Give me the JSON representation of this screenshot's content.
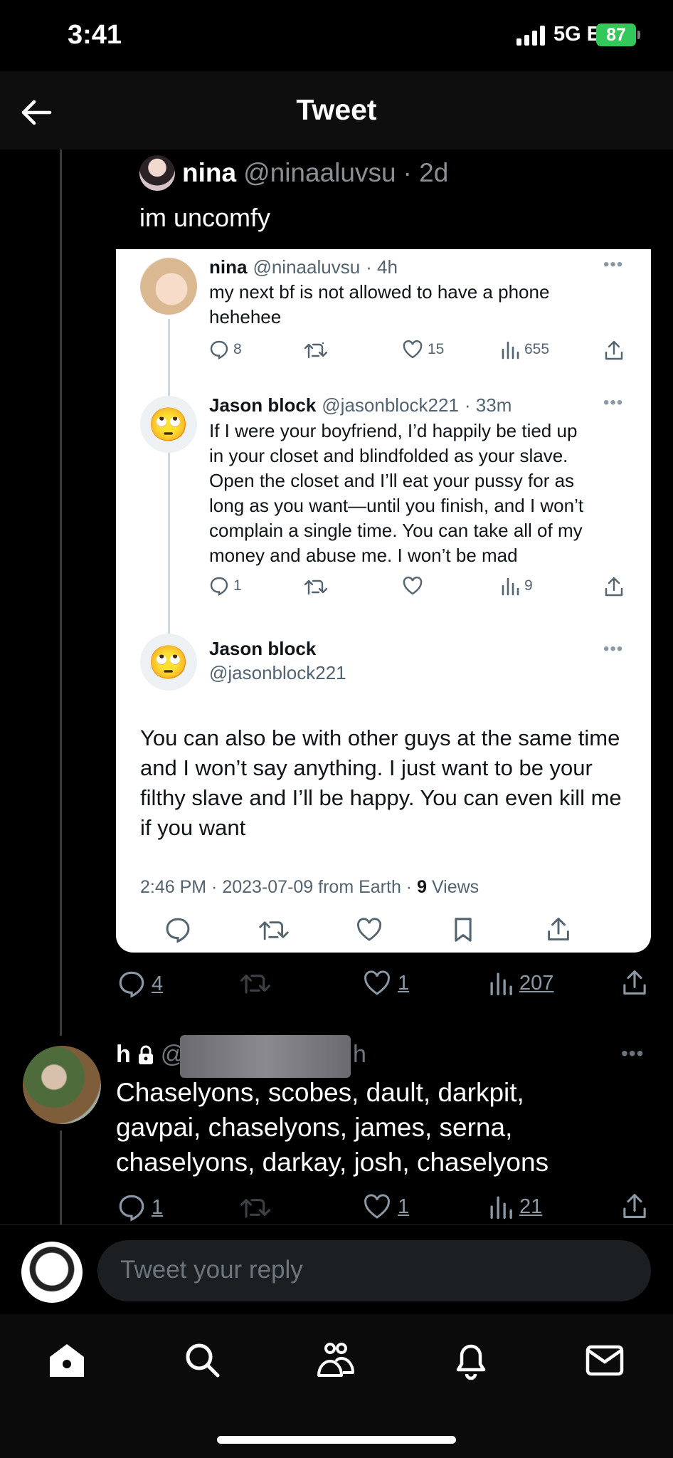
{
  "status": {
    "time": "3:41",
    "network": "5G E",
    "battery": "87"
  },
  "header": {
    "title": "Tweet"
  },
  "quoted": {
    "name": "nina",
    "handle": "@ninaaluvsu",
    "age": "· 2d",
    "text": "im uncomfy"
  },
  "card": {
    "t1": {
      "name": "nina",
      "handle": "@ninaaluvsu",
      "age": "· 4h",
      "lines": [
        "my next bf is not allowed to have a phone",
        "hehehee"
      ],
      "replies": "8",
      "likes": "15",
      "views": "655"
    },
    "t2": {
      "name": "Jason block",
      "handle": "@jasonblock221",
      "age": "· 33m",
      "lines": [
        "If I were your boyfriend, I’d happily be tied up",
        "in your closet and blindfolded as your slave.",
        "Open the closet and I’ll eat your pussy for as",
        "long as you want—until you finish, and I won’t",
        "complain a single time. You can take all of my",
        "money and abuse me. I won’t be mad"
      ],
      "replies": "1",
      "views": "9"
    },
    "t3": {
      "name": "Jason block",
      "handle": "@jasonblock221",
      "lines": [
        "You can also be with other guys at the same time",
        "and I won’t say anything. I just want to be your",
        "filthy slave and I’ll be happy. You can even kill me",
        "if you want"
      ],
      "meta": "2:46 PM · 2023-07-09 from Earth ·",
      "views_count": "9",
      "views_label": "Views"
    },
    "emoji": "🙄"
  },
  "main_actions": {
    "replies": "4",
    "likes": "1",
    "views": "207"
  },
  "reply_tweet": {
    "name": "h",
    "handle_start": "@",
    "handle_end": "h",
    "lines": [
      "Chaselyons, scobes, dault, darkpit,",
      "gavpai, chaselyons, james, serna,",
      "chaselyons, darkay, josh, chaselyons"
    ],
    "replies": "1",
    "likes": "1",
    "views": "21"
  },
  "composer": {
    "placeholder": "Tweet your reply"
  },
  "icons": {
    "back": "back-arrow-icon",
    "more": "more-icon",
    "reply": "reply-icon",
    "retweet": "retweet-icon",
    "like": "like-icon",
    "views": "views-icon",
    "share": "share-icon",
    "bookmark": "bookmark-icon",
    "lock": "lock-icon",
    "home": "home-icon",
    "search": "search-icon",
    "communities": "communities-icon",
    "notifications": "bell-icon",
    "messages": "mail-icon"
  }
}
